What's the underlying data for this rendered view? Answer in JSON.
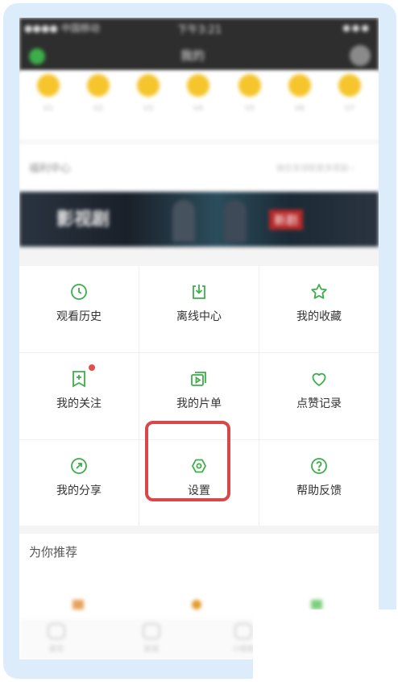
{
  "status_bar": {
    "carrier": "●●●● 中国移动",
    "time": "下午3:21",
    "battery": "●●●"
  },
  "nav": {
    "title": "我的"
  },
  "levels": [
    {
      "label": "V1"
    },
    {
      "label": "V2"
    },
    {
      "label": "V3"
    },
    {
      "label": "V4"
    },
    {
      "label": "V5"
    },
    {
      "label": "V6"
    },
    {
      "label": "V7"
    }
  ],
  "member": {
    "title": "福利中心",
    "subtitle": "做任务领取更多奖励 ›"
  },
  "banner": {
    "text_left": "影视剧",
    "text_right": "新剧"
  },
  "menu": [
    {
      "label": "观看历史",
      "icon": "clock-icon"
    },
    {
      "label": "离线中心",
      "icon": "download-icon"
    },
    {
      "label": "我的收藏",
      "icon": "star-icon"
    },
    {
      "label": "我的关注",
      "icon": "bookmark-plus-icon",
      "badge": true
    },
    {
      "label": "我的片单",
      "icon": "playlist-icon"
    },
    {
      "label": "点赞记录",
      "icon": "heart-icon"
    },
    {
      "label": "我的分享",
      "icon": "share-icon"
    },
    {
      "label": "设置",
      "icon": "gear-icon"
    },
    {
      "label": "帮助反馈",
      "icon": "help-icon"
    }
  ],
  "recommend": {
    "title": "为你推荐"
  },
  "tabs": [
    {
      "label": "首页"
    },
    {
      "label": "影视"
    },
    {
      "label": "小视频"
    }
  ],
  "colors": {
    "accent": "#3cae4a",
    "highlight": "#d8474a",
    "badge": "#e0504a"
  }
}
